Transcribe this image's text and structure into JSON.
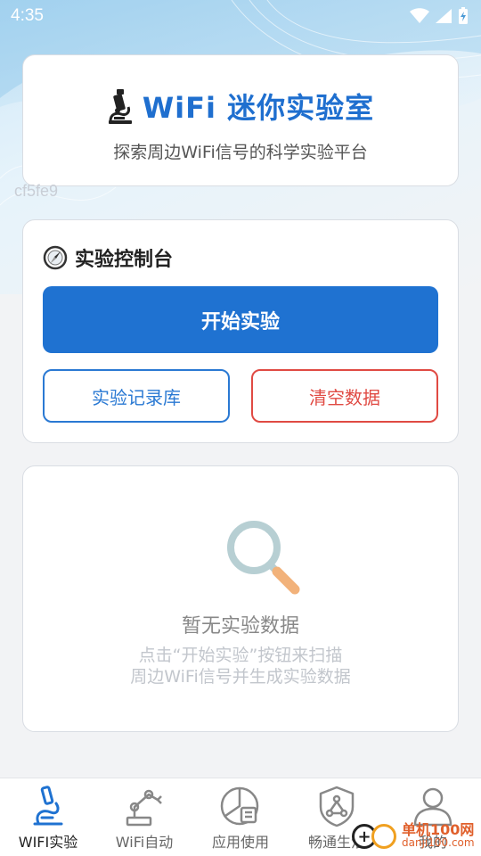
{
  "status_bar": {
    "time": "4:35"
  },
  "header": {
    "title": "WiFi 迷你实验室",
    "subtitle": "探索周边WiFi信号的科学实验平台"
  },
  "watermark_code": "cf5fe9",
  "control": {
    "title": "实验控制台",
    "start_label": "开始实验",
    "records_label": "实验记录库",
    "clear_label": "清空数据"
  },
  "empty_state": {
    "title": "暂无实验数据",
    "line1": "点击“开始实验”按钮来扫描",
    "line2": "周边WiFi信号并生成实验数据"
  },
  "nav": {
    "items": [
      {
        "label": "WIFI实验",
        "icon": "microscope-icon",
        "active": true
      },
      {
        "label": "WiFi自动",
        "icon": "robot-arm-icon",
        "active": false
      },
      {
        "label": "应用使用",
        "icon": "pie-chart-icon",
        "active": false
      },
      {
        "label": "畅通生活",
        "icon": "shield-icon",
        "active": false
      },
      {
        "label": "我的",
        "icon": "user-icon",
        "active": false
      }
    ]
  },
  "badge": {
    "cn": "单机100网",
    "en": "danji100.com"
  },
  "colors": {
    "primary": "#1f72d1",
    "danger": "#e04a43",
    "title_blue": "#1f6fcf"
  }
}
